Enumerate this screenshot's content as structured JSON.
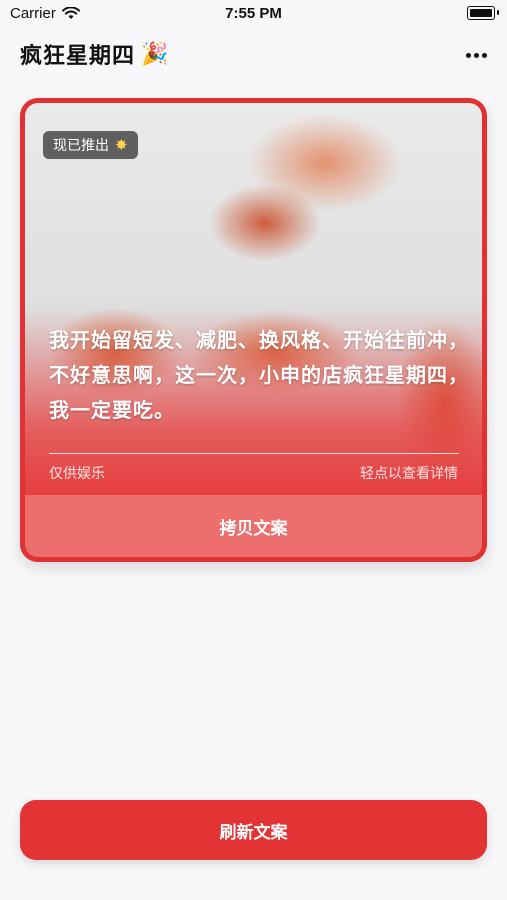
{
  "status_bar": {
    "carrier": "Carrier",
    "time": "7:55 PM"
  },
  "nav": {
    "title": "疯狂星期四",
    "title_emoji": "🎉"
  },
  "card": {
    "badge_label": "现已推出",
    "badge_icon": "sparkle-icon",
    "quote": "我开始留短发、减肥、换风格、开始往前冲，不好意思啊，这一次，小申的店疯狂星期四，我一定要吃。",
    "footer_left": "仅供娱乐",
    "footer_right": "轻点以查看详情",
    "copy_label": "拷贝文案"
  },
  "refresh_label": "刷新文案",
  "colors": {
    "accent": "#e23434",
    "copy_button": "#ec6f6d"
  }
}
